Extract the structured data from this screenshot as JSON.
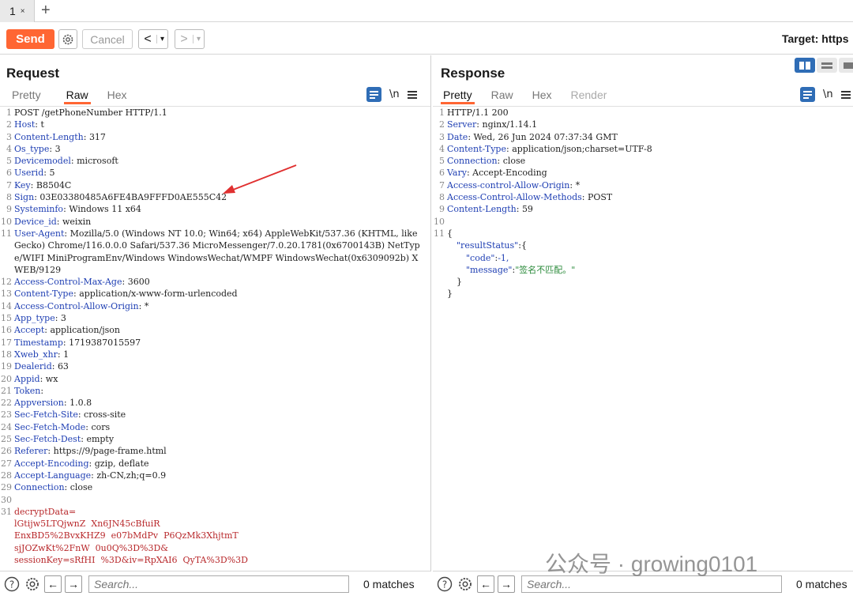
{
  "tabs": [
    {
      "label": "1",
      "close": "×"
    }
  ],
  "new_tab": "+",
  "toolbar": {
    "send": "Send",
    "cancel": "Cancel",
    "back": "<",
    "forward": ">",
    "dropdown": "▾",
    "target_label": "Target: https"
  },
  "request": {
    "title": "Request",
    "tabs": [
      "Pretty",
      "Raw",
      "Hex"
    ],
    "active_tab": "Raw",
    "newline_toggle": "\\n",
    "lines": [
      {
        "n": "1",
        "text": "POST /getPhoneNumber HTTP/1.1"
      },
      {
        "n": "2",
        "key": "Host",
        "val": "t"
      },
      {
        "n": "3",
        "key": "Content-Length",
        "val": "317"
      },
      {
        "n": "4",
        "key": "Os_type",
        "val": "3"
      },
      {
        "n": "5",
        "key": "Devicemodel",
        "val": "microsoft"
      },
      {
        "n": "6",
        "key": "Userid",
        "val": "5"
      },
      {
        "n": "7",
        "key": "Key",
        "val": "B8504C"
      },
      {
        "n": "8",
        "key": "Sign",
        "val": "03E03380485A6FE4BA9FFFD0AE555C42"
      },
      {
        "n": "9",
        "key": "Systeminfo",
        "val": "Windows 11 x64"
      },
      {
        "n": "10",
        "key": "Device_id",
        "val": "weixin"
      },
      {
        "n": "11",
        "key": "User-Agent",
        "val": "Mozilla/5.0 (Windows NT 10.0; Win64; x64) AppleWebKit/537.36 (KHTML, like Gecko) Chrome/116.0.0.0 Safari/537.36 MicroMessenger/7.0.20.1781(0x6700143B) NetType/WIFI MiniProgramEnv/Windows WindowsWechat/WMPF WindowsWechat(0x6309092b) XWEB/9129"
      },
      {
        "n": "12",
        "key": "Access-Control-Max-Age",
        "val": "3600"
      },
      {
        "n": "13",
        "key": "Content-Type",
        "val": "application/x-www-form-urlencoded"
      },
      {
        "n": "14",
        "key": "Access-Control-Allow-Origin",
        "val": "*"
      },
      {
        "n": "15",
        "key": "App_type",
        "val": "3"
      },
      {
        "n": "16",
        "key": "Accept",
        "val": "application/json"
      },
      {
        "n": "17",
        "key": "Timestamp",
        "val": "1719387015597"
      },
      {
        "n": "18",
        "key": "Xweb_xhr",
        "val": "1"
      },
      {
        "n": "19",
        "key": "Dealerid",
        "val": "63"
      },
      {
        "n": "20",
        "key": "Appid",
        "val": "wx"
      },
      {
        "n": "21",
        "key": "Token",
        "val": ""
      },
      {
        "n": "22",
        "key": "Appversion",
        "val": "1.0.8"
      },
      {
        "n": "23",
        "key": "Sec-Fetch-Site",
        "val": "cross-site"
      },
      {
        "n": "24",
        "key": "Sec-Fetch-Mode",
        "val": "cors"
      },
      {
        "n": "25",
        "key": "Sec-Fetch-Dest",
        "val": "empty"
      },
      {
        "n": "26",
        "key": "Referer",
        "val": "https://9/page-frame.html"
      },
      {
        "n": "27",
        "key": "Accept-Encoding",
        "val": "gzip, deflate"
      },
      {
        "n": "28",
        "key": "Accept-Language",
        "val": "zh-CN,zh;q=0.9"
      },
      {
        "n": "29",
        "key": "Connection",
        "val": "close"
      },
      {
        "n": "30",
        "text": ""
      },
      {
        "n": "31",
        "body": "decryptData=\nlGtijw5LTQjwnZ  Xn6JN45cBfuiR\nEnxBD5%2BvxKHZ9  e07bMdPv  P6QzMk3XhjtmT\nsjJOZwKt%2FnW  0u0Q%3D%3D&\nsessionKey=sRfHI  %3D&iv=RpXAI6  QyTA%3D%3D"
      }
    ]
  },
  "response": {
    "title": "Response",
    "tabs": [
      "Pretty",
      "Raw",
      "Hex",
      "Render"
    ],
    "active_tab": "Pretty",
    "newline_toggle": "\\n",
    "lines": [
      {
        "n": "1",
        "text": "HTTP/1.1 200"
      },
      {
        "n": "2",
        "key": "Server",
        "val": "nginx/1.14.1"
      },
      {
        "n": "3",
        "key": "Date",
        "val": "Wed, 26 Jun 2024 07:37:34 GMT"
      },
      {
        "n": "4",
        "key": "Content-Type",
        "val": "application/json;charset=UTF-8"
      },
      {
        "n": "5",
        "key": "Connection",
        "val": "close"
      },
      {
        "n": "6",
        "key": "Vary",
        "val": "Accept-Encoding"
      },
      {
        "n": "7",
        "key": "Access-control-Allow-Origin",
        "val": "*"
      },
      {
        "n": "8",
        "key": "Access-Control-Allow-Methods",
        "val": "POST"
      },
      {
        "n": "9",
        "key": "Content-Length",
        "val": "59"
      },
      {
        "n": "10",
        "text": ""
      },
      {
        "n": "11",
        "text": "{"
      }
    ],
    "json": {
      "k1": "\"resultStatus\"",
      "k2": "\"code\"",
      "v2": "-1,",
      "k3": "\"message\"",
      "v3": "\"签名不匹配。\""
    }
  },
  "search": {
    "placeholder": "Search...",
    "matches_left": "0 matches",
    "matches_right": "0 matches"
  },
  "watermark": "公众号 · growing0101"
}
